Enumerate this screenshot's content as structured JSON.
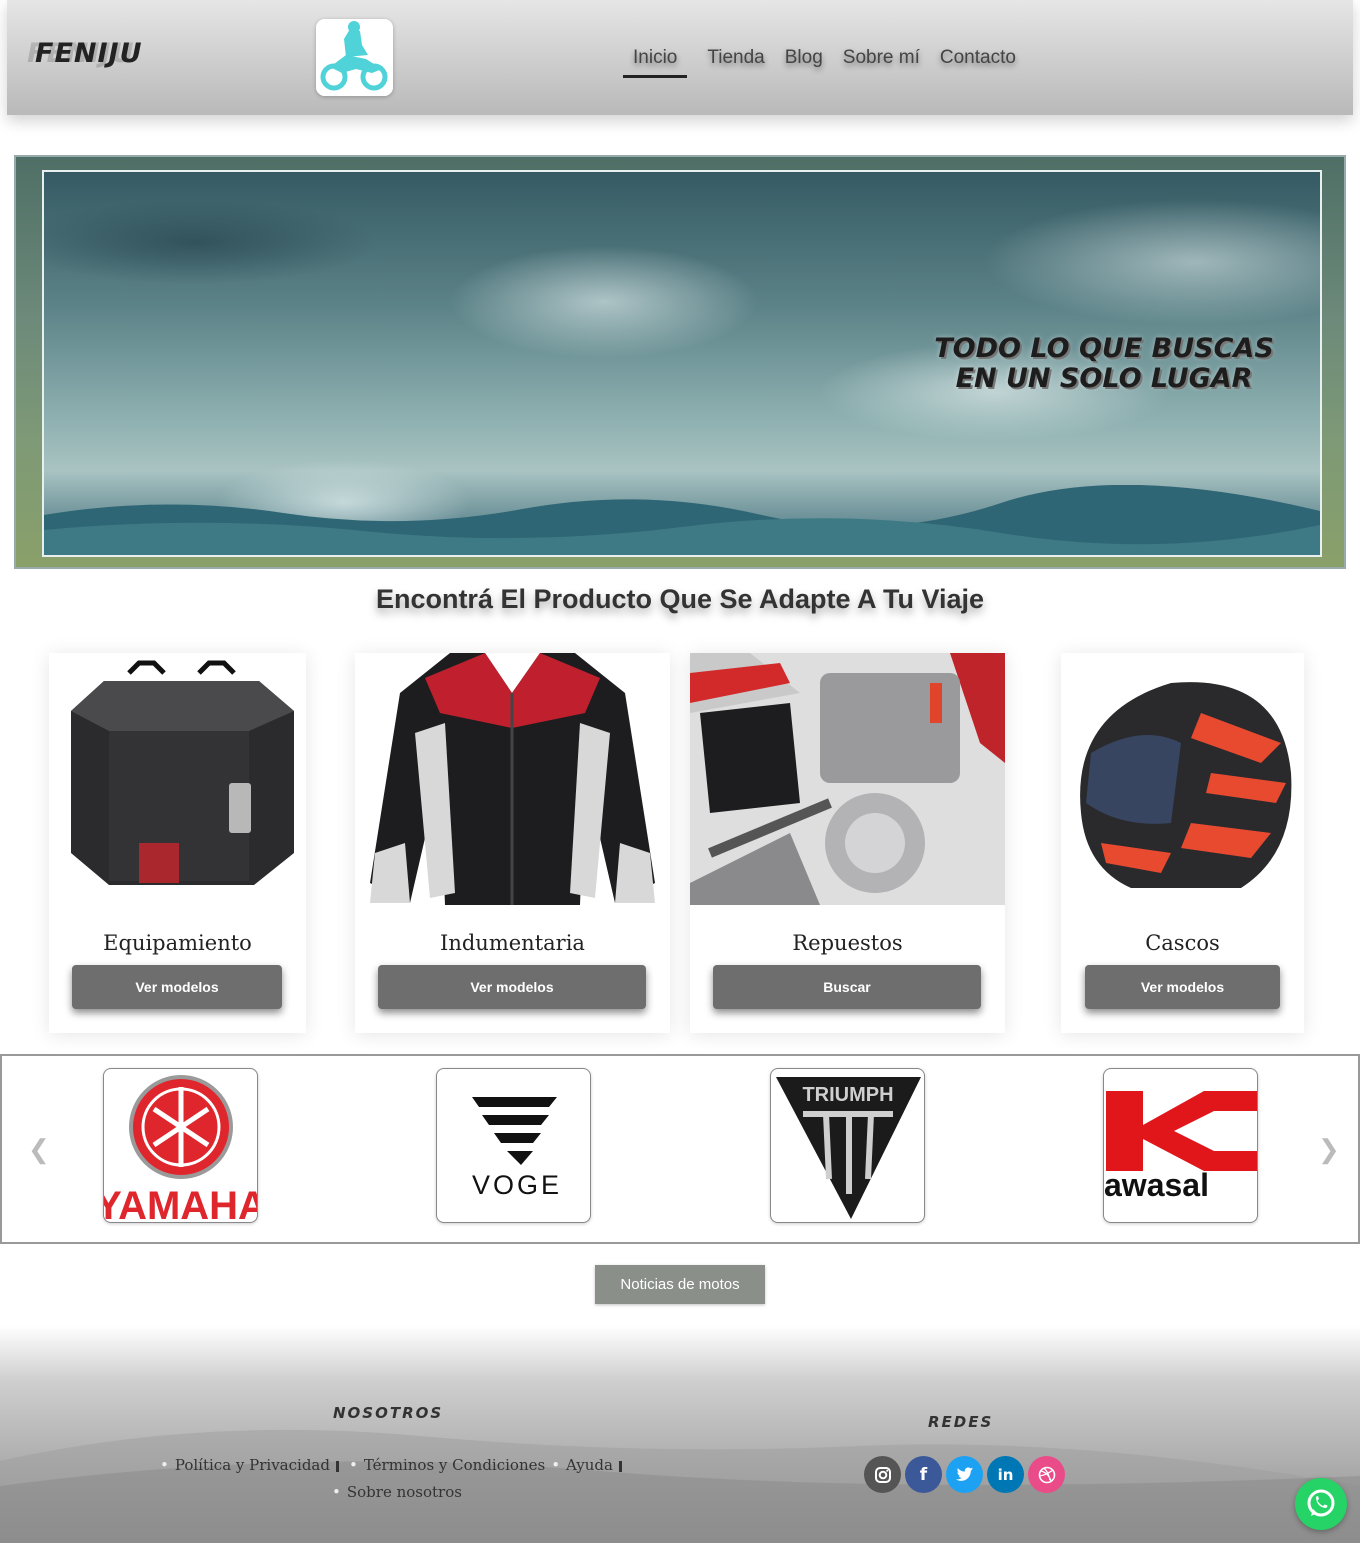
{
  "header": {
    "brand": "FENIJU",
    "nav": [
      {
        "label": "Inicio",
        "active": true
      },
      {
        "label": "Tienda"
      },
      {
        "label": "Blog"
      },
      {
        "label": "Sobre mí"
      },
      {
        "label": "Contacto"
      }
    ]
  },
  "hero": {
    "title": "TODO LO QUE BUSCAS EN UN SOLO LUGAR"
  },
  "section_title": "Encontrá El Producto Que Se Adapte A Tu Viaje",
  "cards": [
    {
      "title": "Equipamiento",
      "button": "Ver modelos"
    },
    {
      "title": "Indumentaria",
      "button": "Ver modelos"
    },
    {
      "title": "Repuestos",
      "button": "Buscar"
    },
    {
      "title": "Cascos",
      "button": "Ver modelos"
    }
  ],
  "brands": [
    {
      "name": "YAMAHA"
    },
    {
      "name": "VOGE"
    },
    {
      "name": "TRIUMPH"
    },
    {
      "name": "awasal"
    }
  ],
  "news_button": "Noticias de motos",
  "footer": {
    "nosotros_heading": "NOSOTROS",
    "redes_heading": "REDES",
    "links": [
      "Política y Privacidad",
      "Términos y Condiciones",
      "Ayuda",
      "Sobre nosotros"
    ],
    "socials": [
      {
        "icon": "instagram-icon",
        "color": "#555555"
      },
      {
        "icon": "facebook-icon",
        "color": "#3b5998"
      },
      {
        "icon": "twitter-icon",
        "color": "#1da1f2"
      },
      {
        "icon": "linkedin-icon",
        "color": "#0077b5"
      },
      {
        "icon": "dribbble-icon",
        "color": "#ea4c89"
      }
    ]
  },
  "colors": {
    "button_gray": "#6e6e6e",
    "news_button": "#8a8f8a",
    "whatsapp": "#25d366"
  }
}
